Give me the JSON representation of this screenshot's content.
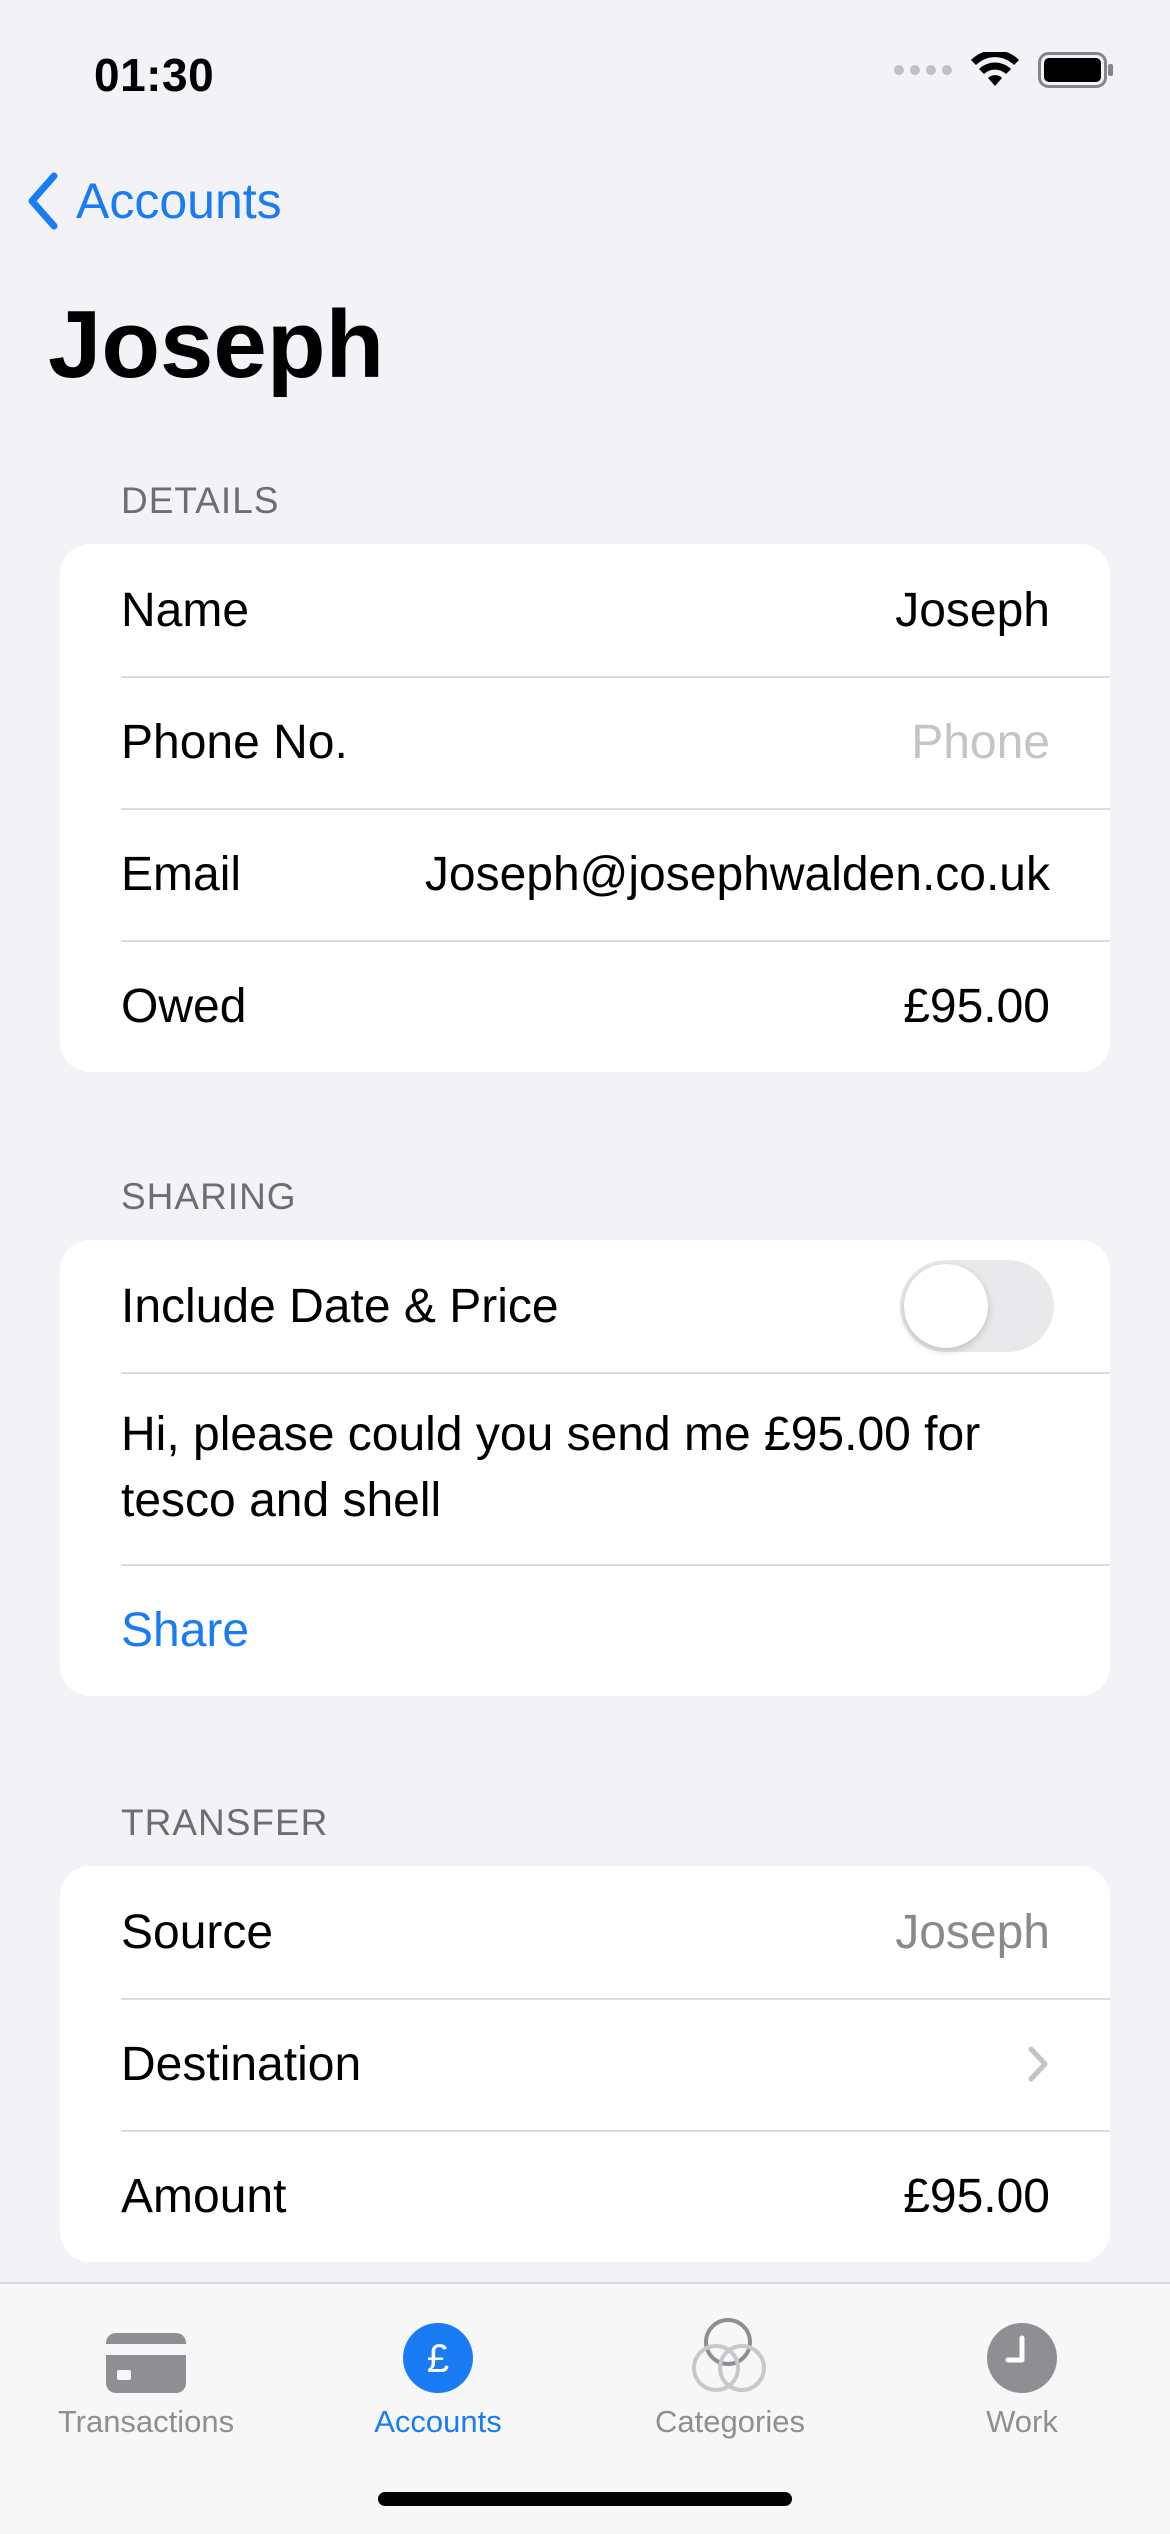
{
  "status_bar": {
    "time": "01:30"
  },
  "nav": {
    "back_label": "Accounts",
    "title": "Joseph"
  },
  "details": {
    "header": "DETAILS",
    "rows": [
      {
        "label": "Name",
        "value": "Joseph"
      },
      {
        "label": "Phone No.",
        "placeholder": "Phone"
      },
      {
        "label": "Email",
        "value": "Joseph@josephwalden.co.uk"
      },
      {
        "label": "Owed",
        "value": "£95.00"
      }
    ]
  },
  "sharing": {
    "header": "SHARING",
    "toggle_label": "Include Date & Price",
    "toggle_on": false,
    "message": "Hi, please could you send me £95.00 for tesco and shell",
    "share_label": "Share"
  },
  "transfer": {
    "header": "TRANSFER",
    "rows": [
      {
        "label": "Source",
        "value": "Joseph"
      },
      {
        "label": "Destination"
      },
      {
        "label": "Amount",
        "value": "£95.00"
      }
    ]
  },
  "tabbar": {
    "tabs": [
      {
        "label": "Transactions",
        "icon": "credit-card-icon"
      },
      {
        "label": "Accounts",
        "icon": "pound-circle-icon",
        "active": true
      },
      {
        "label": "Categories",
        "icon": "circles-icon"
      },
      {
        "label": "Work",
        "icon": "clock-icon"
      }
    ],
    "accounts_glyph": "£"
  },
  "colors": {
    "accent": "#1a7cf4",
    "background": "#f2f2f7",
    "tab_inactive": "#8e8e93"
  }
}
